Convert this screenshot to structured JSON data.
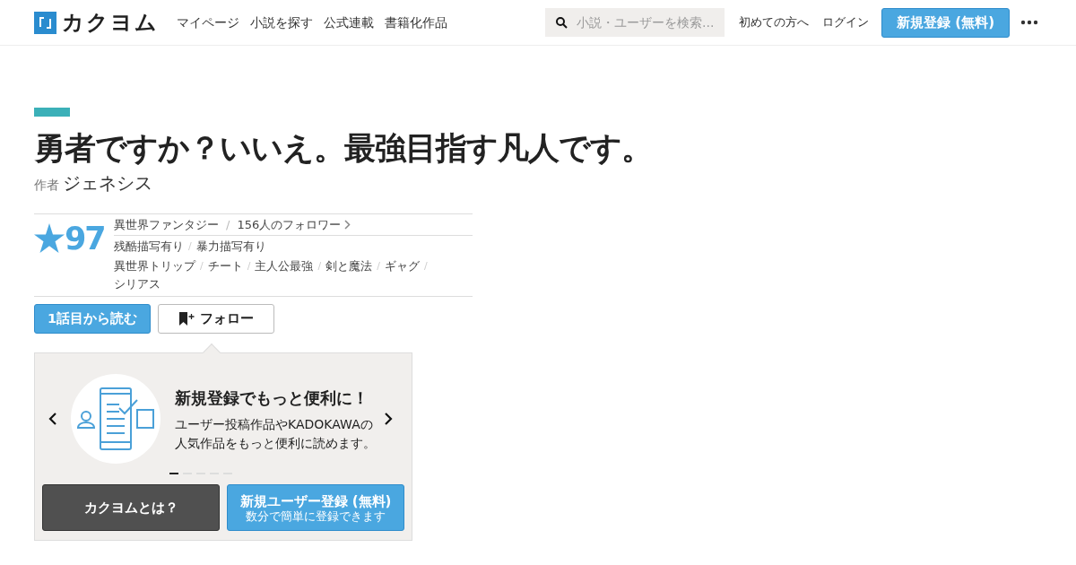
{
  "header": {
    "logo_text": "カクヨム",
    "nav": [
      "マイページ",
      "小説を探す",
      "公式連載",
      "書籍化作品"
    ],
    "search": {
      "placeholder": "小説・ユーザーを検索…"
    },
    "links": [
      "初めての方へ",
      "ログイン"
    ],
    "signup_button": "新規登録 (無料)"
  },
  "work": {
    "title": "勇者ですか？いいえ。最強目指す凡人です。",
    "author_label": "作者",
    "author": "ジェネシス",
    "rating": "97",
    "separator": "/",
    "genre": "異世界ファンタジー",
    "followers": "156人のフォロワー",
    "warnings": [
      "残酷描写有り",
      "暴力描写有り"
    ],
    "tags": [
      "異世界トリップ",
      "チート",
      "主人公最強",
      "剣と魔法",
      "ギャグ",
      "シリアス"
    ],
    "read_button": "1話目から読む",
    "follow_button": "フォロー"
  },
  "promo": {
    "heading": "新規登録でもっと便利に！",
    "body": "ユーザー投稿作品やKADOKAWAの人気作品をもっと便利に読めます。",
    "slides": [
      {
        "selected": true
      },
      {
        "selected": false
      },
      {
        "selected": false
      },
      {
        "selected": false
      },
      {
        "selected": false
      }
    ],
    "about_button": "カクヨムとは？",
    "register_button": "新規ユーザー登録 (無料)",
    "register_sub": "数分で簡単に登録できます"
  }
}
